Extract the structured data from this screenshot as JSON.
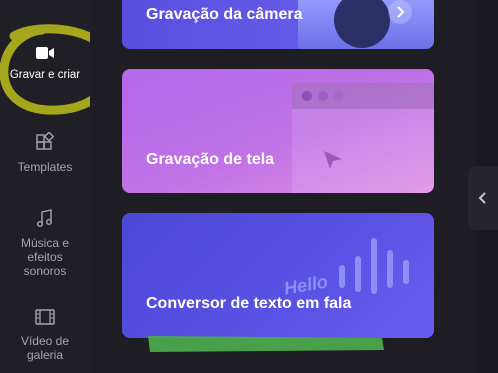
{
  "sidebar": {
    "items": [
      {
        "label": "Gravar e criar",
        "icon": "video-camera-icon",
        "active": true
      },
      {
        "label": "Templates",
        "icon": "templates-icon",
        "active": false
      },
      {
        "label": "Música e efeitos sonoros",
        "icon": "music-note-icon",
        "active": false
      },
      {
        "label": "Vídeo de galeria",
        "icon": "film-strip-icon",
        "active": false
      }
    ]
  },
  "cards": [
    {
      "title": "Gravação da câmera",
      "color_start": "#5b4fe0",
      "color_end": "#7466ef"
    },
    {
      "title": "Gravação de tela",
      "color_start": "#c46be6",
      "color_end": "#a856de"
    },
    {
      "title": "Conversor de texto em fala",
      "color_start": "#4c46d6",
      "color_end": "#6b5cf0",
      "art_text": "Hello"
    }
  ],
  "colors": {
    "sidebar_bg": "#201f25",
    "main_bg": "#1e1d23",
    "highlight_circle": "#a6a61d",
    "highlight_underline": "#4caf50"
  }
}
